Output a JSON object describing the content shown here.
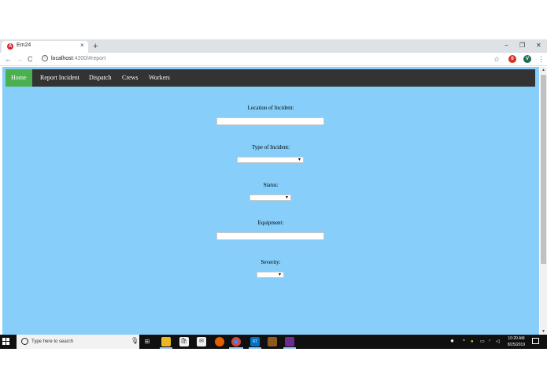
{
  "browser": {
    "tab_title": "Em24",
    "url_host": "localhost",
    "url_path": ":4200/#report",
    "new_tab_symbol": "+",
    "close_symbol": "×",
    "back_symbol": "←",
    "forward_symbol": "→",
    "reload_symbol": "C",
    "star_symbol": "☆",
    "menu_symbol": "⋮",
    "minimize_symbol": "−",
    "restore_symbol": "❐",
    "window_close_symbol": "✕",
    "extension1_glyph": "0",
    "extension2_glyph": "V"
  },
  "nav": {
    "items": [
      {
        "label": "Home",
        "active": true
      },
      {
        "label": "Report Incident",
        "active": false
      },
      {
        "label": "Dispatch",
        "active": false
      },
      {
        "label": "Crews",
        "active": false
      },
      {
        "label": "Workers",
        "active": false
      }
    ]
  },
  "form": {
    "location_label": "Location of Incident:",
    "location_value": "",
    "type_label": "Type of Incident:",
    "type_value": "",
    "status_label": "Status:",
    "status_value": "",
    "equipment_label": "Equipment:",
    "equipment_value": "",
    "severity_label": "Severity:",
    "severity_value": "",
    "select_arrow": "▼"
  },
  "taskbar": {
    "search_placeholder": "Type here to search",
    "clock_time": "10:20 AM",
    "clock_date": "8/25/2019",
    "mail_badge": "67"
  },
  "colors": {
    "page_background": "#87cefa",
    "navbar": "#333333",
    "nav_active": "#4caf50"
  }
}
